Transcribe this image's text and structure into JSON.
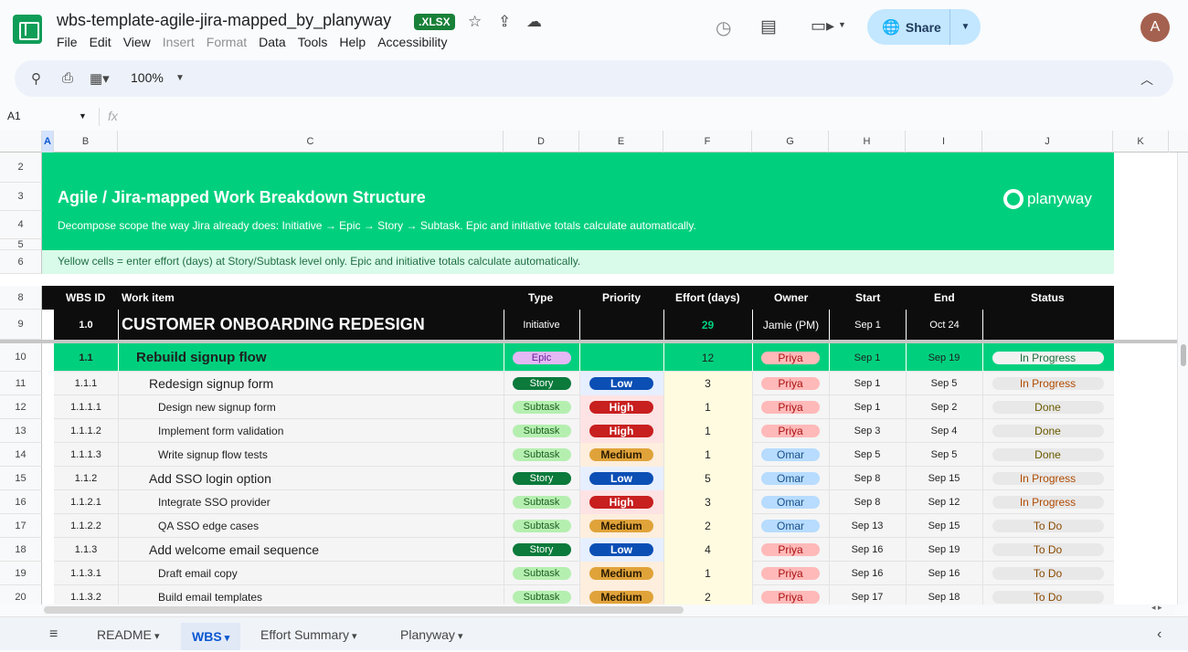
{
  "doc": {
    "title": "wbs-template-agile-jira-mapped_by_planyway",
    "badge": ".XLSX"
  },
  "menu": [
    "File",
    "Edit",
    "View",
    "Insert",
    "Format",
    "Data",
    "Tools",
    "Help",
    "Accessibility"
  ],
  "share_label": "Share",
  "avatar_letter": "A",
  "toolbar": {
    "zoom": "100%"
  },
  "formula": {
    "cell_ref": "A1",
    "fx": "fx"
  },
  "columns": [
    "A",
    "B",
    "C",
    "D",
    "E",
    "F",
    "G",
    "H",
    "I",
    "J",
    "K"
  ],
  "row_numbers": [
    "2",
    "3",
    "4",
    "5",
    "6",
    "8",
    "9",
    "10",
    "11",
    "12",
    "13",
    "14",
    "15",
    "16",
    "17",
    "18",
    "19",
    "20"
  ],
  "banner": {
    "title": "Agile / Jira-mapped Work Breakdown Structure",
    "subtitle": "Decompose scope the way Jira already does: Initiative → Epic → Story → Subtask. Epic and initiative totals calculate automatically.",
    "brand": "planyway",
    "note": "Yellow cells = enter effort (days) at Story/Subtask level only. Epic and initiative totals calculate automatically."
  },
  "headers": {
    "wbs": "WBS ID",
    "item": "Work item",
    "type": "Type",
    "priority": "Priority",
    "effort": "Effort (days)",
    "owner": "Owner",
    "start": "Start",
    "end": "End",
    "status": "Status"
  },
  "initiative": {
    "wbs": "1.0",
    "item": "CUSTOMER ONBOARDING REDESIGN",
    "type": "Initiative",
    "effort": "29",
    "owner": "Jamie (PM)",
    "start": "Sep 1",
    "end": "Oct 24"
  },
  "rows": [
    {
      "wbs": "1.1",
      "item": "Rebuild signup flow",
      "type": "Epic",
      "priority": "",
      "effort": "12",
      "owner": "Priya",
      "start": "Sep 1",
      "end": "Sep 19",
      "status": "In Progress",
      "level": "epic"
    },
    {
      "wbs": "1.1.1",
      "item": "Redesign signup form",
      "type": "Story",
      "priority": "Low",
      "effort": "3",
      "owner": "Priya",
      "start": "Sep 1",
      "end": "Sep 5",
      "status": "In Progress",
      "level": "story"
    },
    {
      "wbs": "1.1.1.1",
      "item": "Design new signup form",
      "type": "Subtask",
      "priority": "High",
      "effort": "1",
      "owner": "Priya",
      "start": "Sep 1",
      "end": "Sep 2",
      "status": "Done",
      "level": "sub"
    },
    {
      "wbs": "1.1.1.2",
      "item": "Implement form validation",
      "type": "Subtask",
      "priority": "High",
      "effort": "1",
      "owner": "Priya",
      "start": "Sep 3",
      "end": "Sep 4",
      "status": "Done",
      "level": "sub"
    },
    {
      "wbs": "1.1.1.3",
      "item": "Write signup flow tests",
      "type": "Subtask",
      "priority": "Medium",
      "effort": "1",
      "owner": "Omar",
      "start": "Sep 5",
      "end": "Sep 5",
      "status": "Done",
      "level": "sub"
    },
    {
      "wbs": "1.1.2",
      "item": "Add SSO login option",
      "type": "Story",
      "priority": "Low",
      "effort": "5",
      "owner": "Omar",
      "start": "Sep 8",
      "end": "Sep 15",
      "status": "In Progress",
      "level": "story"
    },
    {
      "wbs": "1.1.2.1",
      "item": "Integrate SSO provider",
      "type": "Subtask",
      "priority": "High",
      "effort": "3",
      "owner": "Omar",
      "start": "Sep 8",
      "end": "Sep 12",
      "status": "In Progress",
      "level": "sub"
    },
    {
      "wbs": "1.1.2.2",
      "item": "QA SSO edge cases",
      "type": "Subtask",
      "priority": "Medium",
      "effort": "2",
      "owner": "Omar",
      "start": "Sep 13",
      "end": "Sep 15",
      "status": "To Do",
      "level": "sub"
    },
    {
      "wbs": "1.1.3",
      "item": "Add welcome email sequence",
      "type": "Story",
      "priority": "Low",
      "effort": "4",
      "owner": "Priya",
      "start": "Sep 16",
      "end": "Sep 19",
      "status": "To Do",
      "level": "story"
    },
    {
      "wbs": "1.1.3.1",
      "item": "Draft email copy",
      "type": "Subtask",
      "priority": "Medium",
      "effort": "1",
      "owner": "Priya",
      "start": "Sep 16",
      "end": "Sep 16",
      "status": "To Do",
      "level": "sub"
    },
    {
      "wbs": "1.1.3.2",
      "item": "Build email templates",
      "type": "Subtask",
      "priority": "Medium",
      "effort": "2",
      "owner": "Priya",
      "start": "Sep 17",
      "end": "Sep 18",
      "status": "To Do",
      "level": "sub"
    }
  ],
  "sheet_tabs": [
    "README",
    "WBS",
    "Effort Summary",
    "Planyway"
  ],
  "active_tab": "WBS",
  "colors": {
    "banner": "#00d07e",
    "epic": "#00d07e",
    "header": "#0d0d0d"
  }
}
